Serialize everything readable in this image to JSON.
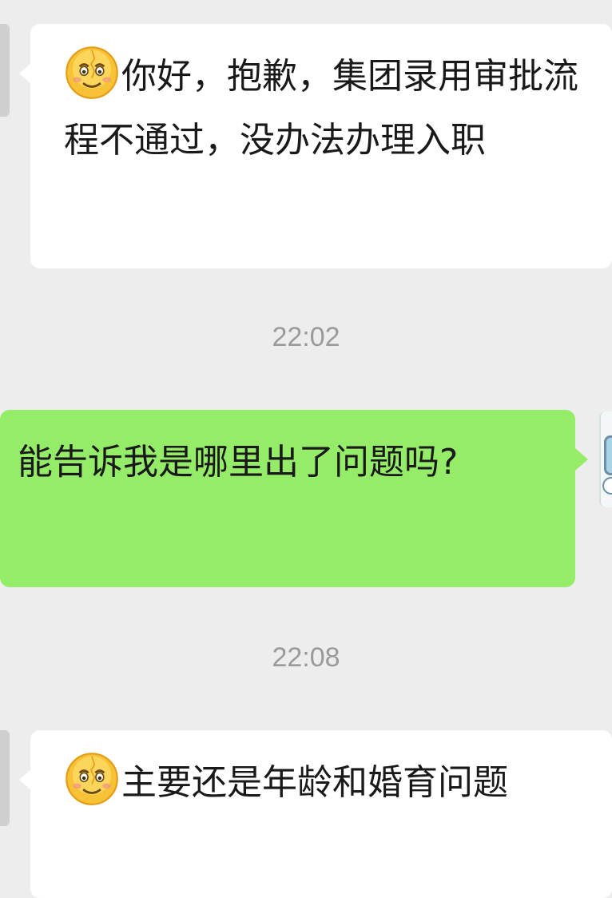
{
  "conversation": {
    "messages": [
      {
        "direction": "incoming",
        "emoji": "awkward-smile-emoji",
        "text": "你好，抱歉，集团录用审批流程不通过，没办法办理入职"
      },
      {
        "direction": "outgoing",
        "text": "能告诉我是哪里出了问题吗?"
      },
      {
        "direction": "incoming",
        "emoji": "awkward-smile-emoji",
        "text": "主要还是年龄和婚育问题"
      }
    ],
    "timestamps": [
      "22:02",
      "22:08"
    ]
  },
  "colors": {
    "background": "#ededed",
    "incoming_bubble": "#ffffff",
    "outgoing_bubble": "#95ec69",
    "timestamp_text": "#9a9a9a",
    "message_text": "#191919"
  }
}
